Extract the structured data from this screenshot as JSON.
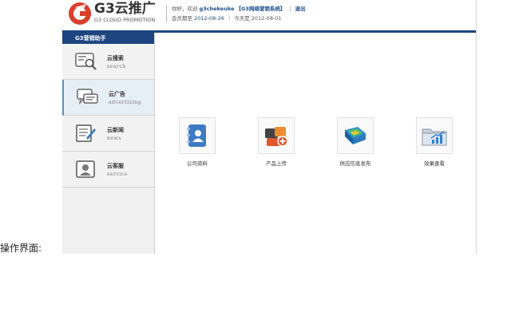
{
  "caption": "操作界面:",
  "header": {
    "logo_title": "G3云推广",
    "logo_sub": "G3 CLOUD PROMOTION",
    "greeting": "你好，欢迎",
    "username": "g3chekeuke",
    "system_name": "【G3网络营销系统】",
    "logout": "退出",
    "member_label": "会员期至",
    "member_date": "2012-08-26",
    "today_label": "今天是",
    "today_date": "2012-08-01"
  },
  "sidebar": {
    "title": "G3营销助手",
    "items": [
      {
        "label": "云搜索",
        "sub": "search",
        "icon": "search-computer-icon"
      },
      {
        "label": "云广告",
        "sub": "advertising",
        "icon": "chat-bubbles-icon"
      },
      {
        "label": "云新闻",
        "sub": "news",
        "icon": "news-edit-icon"
      },
      {
        "label": "云客服",
        "sub": "service",
        "icon": "customer-service-icon"
      }
    ]
  },
  "tiles": [
    {
      "label": "公司资料",
      "icon": "address-book-icon"
    },
    {
      "label": "产品上传",
      "icon": "product-upload-icon"
    },
    {
      "label": "供应信息发布",
      "icon": "supply-info-book-icon"
    },
    {
      "label": "效果查看",
      "icon": "folder-chart-icon"
    }
  ],
  "colors": {
    "brand_blue": "#1d4680",
    "accent_red": "#d9402b",
    "link_blue": "#1a4e8c"
  }
}
